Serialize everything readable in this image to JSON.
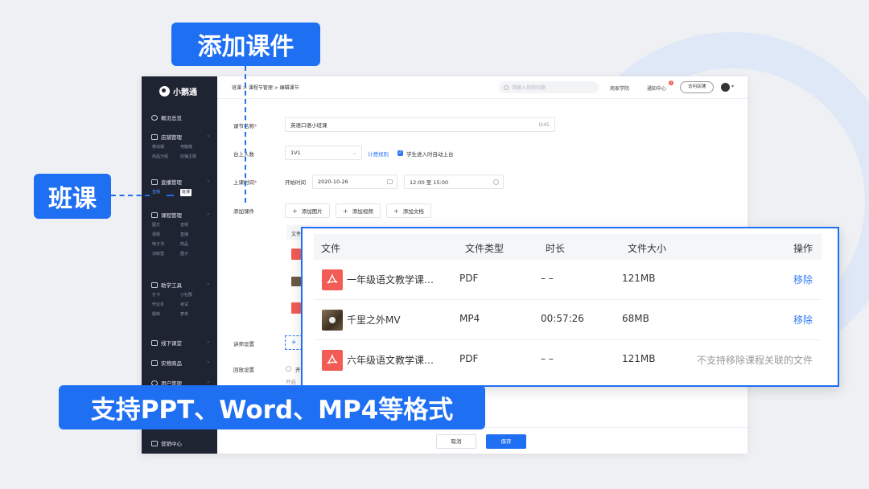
{
  "annotations": {
    "add_courseware": "添加课件",
    "class_lesson": "班课",
    "formats": "支持PPT、Word、MP4等格式"
  },
  "app": {
    "logo": "小鹅通",
    "sidebar": {
      "overview": "概况总览",
      "store": {
        "label": "店铺管理",
        "items": [
          "移动端",
          "电脑端",
          "商品分组",
          "店铺主题"
        ]
      },
      "live": {
        "label": "直播管理",
        "items": [
          "直播",
          "班课"
        ]
      },
      "course": {
        "label": "课程管理",
        "items": [
          "图文",
          "音频",
          "视频",
          "直播",
          "电子书",
          "商品",
          "训练营",
          "圈子"
        ]
      },
      "tools": {
        "label": "助学工具",
        "items": [
          "打卡",
          "小社群",
          "作业本",
          "考试",
          "题库",
          "表单"
        ]
      },
      "offline": "线下课堂",
      "physical": "实物商品",
      "users": "用户管理",
      "marketing": "营销中心"
    },
    "topbar": {
      "breadcrumb": "班课 > 课程节管理 > 编辑课节",
      "search_placeholder": "请输入你的问题",
      "merchant_academy": "商家学院",
      "notification_center": "通知中心",
      "notification_count": "1",
      "visit_store": "访问店铺"
    },
    "form": {
      "name_label": "课节名称",
      "name_value": "英语口语小班课",
      "name_count": "0/45",
      "seats_label": "台上人数",
      "seats_value": "1V1",
      "billing_rule": "计费规则",
      "auto_stage": "学生进入时自动上台",
      "time_label": "上课时间",
      "start_time_label": "开始时间",
      "date_value": "2020-10-26",
      "time_range": "12:00 至 15:00",
      "courseware_label": "添加课件",
      "add_image": "添加图片",
      "add_video": "添加视频",
      "add_doc": "添加文档",
      "file_col_short": "文件",
      "lecturer_label": "讲师设置",
      "playback_label": "回放设置",
      "playback_option": "开",
      "playback_hint": "开启"
    },
    "footer": {
      "cancel": "取消",
      "save": "保存"
    }
  },
  "file_table": {
    "headers": {
      "file": "文件",
      "type": "文件类型",
      "duration": "时长",
      "size": "文件大小",
      "action": "操作"
    },
    "rows": [
      {
        "name": "一年级语文教学课…",
        "type": "PDF",
        "duration": "– –",
        "size": "121MB",
        "action": "移除",
        "icon": "pdf-icon"
      },
      {
        "name": "千里之外MV",
        "type": "MP4",
        "duration": "00:57:26",
        "size": "68MB",
        "action": "移除",
        "icon": "video-thumbnail"
      },
      {
        "name": "六年级语文教学课…",
        "type": "PDF",
        "duration": "– –",
        "size": "121MB",
        "action": "不支持移除课程关联的文件",
        "icon": "pdf-icon"
      }
    ]
  },
  "colors": {
    "accent": "#1f6ff2",
    "sidebar": "#1f2433",
    "pdf": "#f25c54",
    "link": "#2f7bf5"
  }
}
